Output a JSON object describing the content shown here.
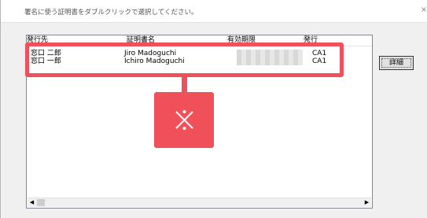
{
  "dialog": {
    "instruction": "署名に使う証明書をダブルクリックで選択してください。",
    "close_glyph": "×"
  },
  "list": {
    "columns": [
      "発行先",
      "証明書名",
      "有効期限",
      "発行"
    ],
    "rows": [
      {
        "issued_to": "窓口 二郎",
        "cert_name": "Jiro Madoguchi",
        "expiry_redacted": true,
        "issuer": "CA1"
      },
      {
        "issued_to": "窓口 一郎",
        "cert_name": "Ichiro Madoguchi",
        "expiry_redacted": true,
        "issuer": "CA1"
      }
    ]
  },
  "scrollbar": {
    "left_arrow": "◀",
    "right_arrow": "▶"
  },
  "buttons": {
    "detail_label": "詳細"
  },
  "annotation": {
    "icon": "x-mark-icon",
    "color": "#f0505a"
  }
}
